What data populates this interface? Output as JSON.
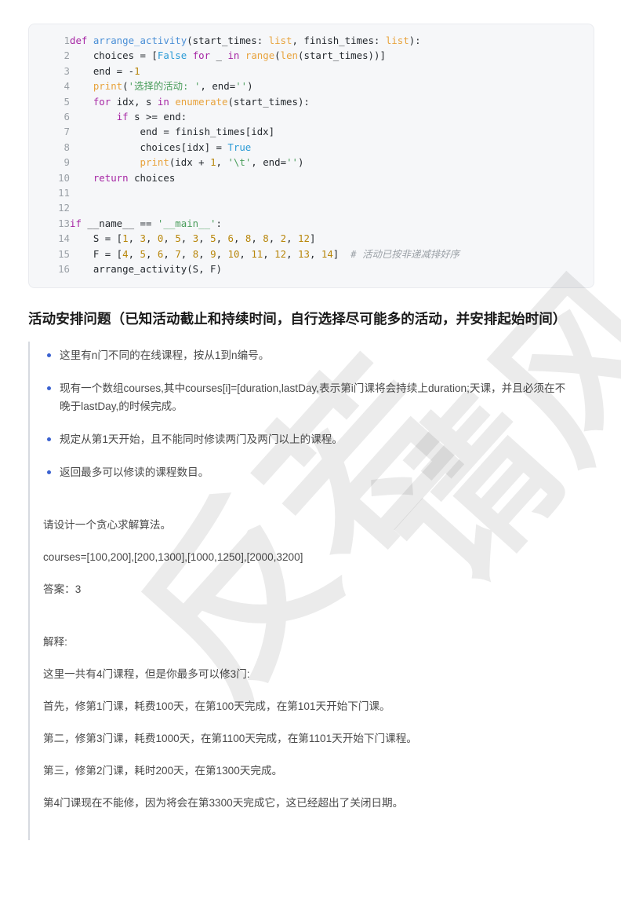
{
  "code_block": {
    "language": "python",
    "lines": [
      {
        "no": "1",
        "tokens": [
          {
            "t": "def ",
            "c": "k"
          },
          {
            "t": "arrange_activity",
            "c": "fn"
          },
          {
            "t": "(start_times: ",
            "c": "op"
          },
          {
            "t": "list",
            "c": "ty"
          },
          {
            "t": ", finish_times: ",
            "c": "op"
          },
          {
            "t": "list",
            "c": "ty"
          },
          {
            "t": "):",
            "c": "op"
          }
        ]
      },
      {
        "no": "2",
        "tokens": [
          {
            "t": "    choices = [",
            "c": "op"
          },
          {
            "t": "False",
            "c": "kb"
          },
          {
            "t": " ",
            "c": "op"
          },
          {
            "t": "for",
            "c": "k"
          },
          {
            "t": " _ ",
            "c": "op"
          },
          {
            "t": "in",
            "c": "k"
          },
          {
            "t": " ",
            "c": "op"
          },
          {
            "t": "range",
            "c": "bi"
          },
          {
            "t": "(",
            "c": "op"
          },
          {
            "t": "len",
            "c": "bi"
          },
          {
            "t": "(start_times))]",
            "c": "op"
          }
        ]
      },
      {
        "no": "3",
        "tokens": [
          {
            "t": "    end = -",
            "c": "op"
          },
          {
            "t": "1",
            "c": "nu"
          }
        ]
      },
      {
        "no": "4",
        "tokens": [
          {
            "t": "    ",
            "c": "op"
          },
          {
            "t": "print",
            "c": "bi"
          },
          {
            "t": "(",
            "c": "op"
          },
          {
            "t": "'选择的活动: '",
            "c": "st"
          },
          {
            "t": ", end=",
            "c": "op"
          },
          {
            "t": "''",
            "c": "st"
          },
          {
            "t": ")",
            "c": "op"
          }
        ]
      },
      {
        "no": "5",
        "tokens": [
          {
            "t": "    ",
            "c": "op"
          },
          {
            "t": "for",
            "c": "k"
          },
          {
            "t": " idx, s ",
            "c": "op"
          },
          {
            "t": "in",
            "c": "k"
          },
          {
            "t": " ",
            "c": "op"
          },
          {
            "t": "enumerate",
            "c": "bi"
          },
          {
            "t": "(start_times):",
            "c": "op"
          }
        ]
      },
      {
        "no": "6",
        "tokens": [
          {
            "t": "        ",
            "c": "op"
          },
          {
            "t": "if",
            "c": "k"
          },
          {
            "t": " s >= end:",
            "c": "op"
          }
        ]
      },
      {
        "no": "7",
        "tokens": [
          {
            "t": "            end = finish_times[idx]",
            "c": "op"
          }
        ]
      },
      {
        "no": "8",
        "tokens": [
          {
            "t": "            choices[idx] = ",
            "c": "op"
          },
          {
            "t": "True",
            "c": "kb"
          }
        ]
      },
      {
        "no": "9",
        "tokens": [
          {
            "t": "            ",
            "c": "op"
          },
          {
            "t": "print",
            "c": "bi"
          },
          {
            "t": "(idx + ",
            "c": "op"
          },
          {
            "t": "1",
            "c": "nu"
          },
          {
            "t": ", ",
            "c": "op"
          },
          {
            "t": "'\\t'",
            "c": "st"
          },
          {
            "t": ", end=",
            "c": "op"
          },
          {
            "t": "''",
            "c": "st"
          },
          {
            "t": ")",
            "c": "op"
          }
        ]
      },
      {
        "no": "10",
        "tokens": [
          {
            "t": "    ",
            "c": "op"
          },
          {
            "t": "return",
            "c": "k"
          },
          {
            "t": " choices",
            "c": "op"
          }
        ]
      },
      {
        "no": "11",
        "tokens": [
          {
            "t": "",
            "c": "op"
          }
        ]
      },
      {
        "no": "12",
        "tokens": [
          {
            "t": "",
            "c": "op"
          }
        ]
      },
      {
        "no": "13",
        "tokens": [
          {
            "t": "if",
            "c": "k"
          },
          {
            "t": " __name__ ",
            "c": "op"
          },
          {
            "t": "==",
            "c": "op"
          },
          {
            "t": " ",
            "c": "op"
          },
          {
            "t": "'__main__'",
            "c": "st"
          },
          {
            "t": ":",
            "c": "op"
          }
        ]
      },
      {
        "no": "14",
        "tokens": [
          {
            "t": "    S = [",
            "c": "op"
          },
          {
            "t": "1",
            "c": "nu"
          },
          {
            "t": ", ",
            "c": "op"
          },
          {
            "t": "3",
            "c": "nu"
          },
          {
            "t": ", ",
            "c": "op"
          },
          {
            "t": "0",
            "c": "nu"
          },
          {
            "t": ", ",
            "c": "op"
          },
          {
            "t": "5",
            "c": "nu"
          },
          {
            "t": ", ",
            "c": "op"
          },
          {
            "t": "3",
            "c": "nu"
          },
          {
            "t": ", ",
            "c": "op"
          },
          {
            "t": "5",
            "c": "nu"
          },
          {
            "t": ", ",
            "c": "op"
          },
          {
            "t": "6",
            "c": "nu"
          },
          {
            "t": ", ",
            "c": "op"
          },
          {
            "t": "8",
            "c": "nu"
          },
          {
            "t": ", ",
            "c": "op"
          },
          {
            "t": "8",
            "c": "nu"
          },
          {
            "t": ", ",
            "c": "op"
          },
          {
            "t": "2",
            "c": "nu"
          },
          {
            "t": ", ",
            "c": "op"
          },
          {
            "t": "12",
            "c": "nu"
          },
          {
            "t": "]",
            "c": "op"
          }
        ]
      },
      {
        "no": "15",
        "tokens": [
          {
            "t": "    F = [",
            "c": "op"
          },
          {
            "t": "4",
            "c": "nu"
          },
          {
            "t": ", ",
            "c": "op"
          },
          {
            "t": "5",
            "c": "nu"
          },
          {
            "t": ", ",
            "c": "op"
          },
          {
            "t": "6",
            "c": "nu"
          },
          {
            "t": ", ",
            "c": "op"
          },
          {
            "t": "7",
            "c": "nu"
          },
          {
            "t": ", ",
            "c": "op"
          },
          {
            "t": "8",
            "c": "nu"
          },
          {
            "t": ", ",
            "c": "op"
          },
          {
            "t": "9",
            "c": "nu"
          },
          {
            "t": ", ",
            "c": "op"
          },
          {
            "t": "10",
            "c": "nu"
          },
          {
            "t": ", ",
            "c": "op"
          },
          {
            "t": "11",
            "c": "nu"
          },
          {
            "t": ", ",
            "c": "op"
          },
          {
            "t": "12",
            "c": "nu"
          },
          {
            "t": ", ",
            "c": "op"
          },
          {
            "t": "13",
            "c": "nu"
          },
          {
            "t": ", ",
            "c": "op"
          },
          {
            "t": "14",
            "c": "nu"
          },
          {
            "t": "]  ",
            "c": "op"
          },
          {
            "t": "# 活动已按非递减排好序",
            "c": "cm"
          }
        ]
      },
      {
        "no": "16",
        "tokens": [
          {
            "t": "    arrange_activity(S, F)",
            "c": "op"
          }
        ]
      }
    ]
  },
  "section": {
    "title": "活动安排问题（已知活动截止和持续时间，自行选择尽可能多的活动，并安排起始时间）",
    "bullets": [
      "这里有n门不同的在线课程，按从1到n编号。",
      "现有一个数组courses,其中courses[i]=[duration,lastDay,表示第i门课将会持续上duration;天课，并且必须在不晚于lastDay,的时候完成。",
      "规定从第1天开始，且不能同时修读两门及两门以上的课程。",
      "返回最多可以修读的课程数目。"
    ],
    "request": "请设计一个贪心求解算法。",
    "input_data": "courses=[100,200],[200,1300],[1000,1250],[2000,3200]",
    "answer": "答案：3",
    "explanation_label": "解释:",
    "explanation_lines": [
      "这里一共有4门课程，但是你最多可以修3门:",
      "首先，修第1门课，耗费100天，在第100天完成，在第101天开始下门课。",
      "第二，修第3门课，耗费1000天，在第1100天完成，在第1101天开始下门课程。",
      "第三，修第2门课，耗时200天，在第1300天完成。",
      "第4门课现在不能修，因为将会在第3300天完成它，这已经超出了关闭日期。"
    ]
  },
  "watermark": {
    "line_a": "反若",
    "line_b": "请风cyf"
  },
  "colors": {
    "code_background": "#f6f7f9",
    "code_border": "#e9ebef",
    "bullet": "#3a61d0",
    "body_text": "#4a4a4a",
    "heading_text": "#1a1a1a",
    "quote_border": "#d7dae0",
    "line_number": "#9aa0a6"
  }
}
